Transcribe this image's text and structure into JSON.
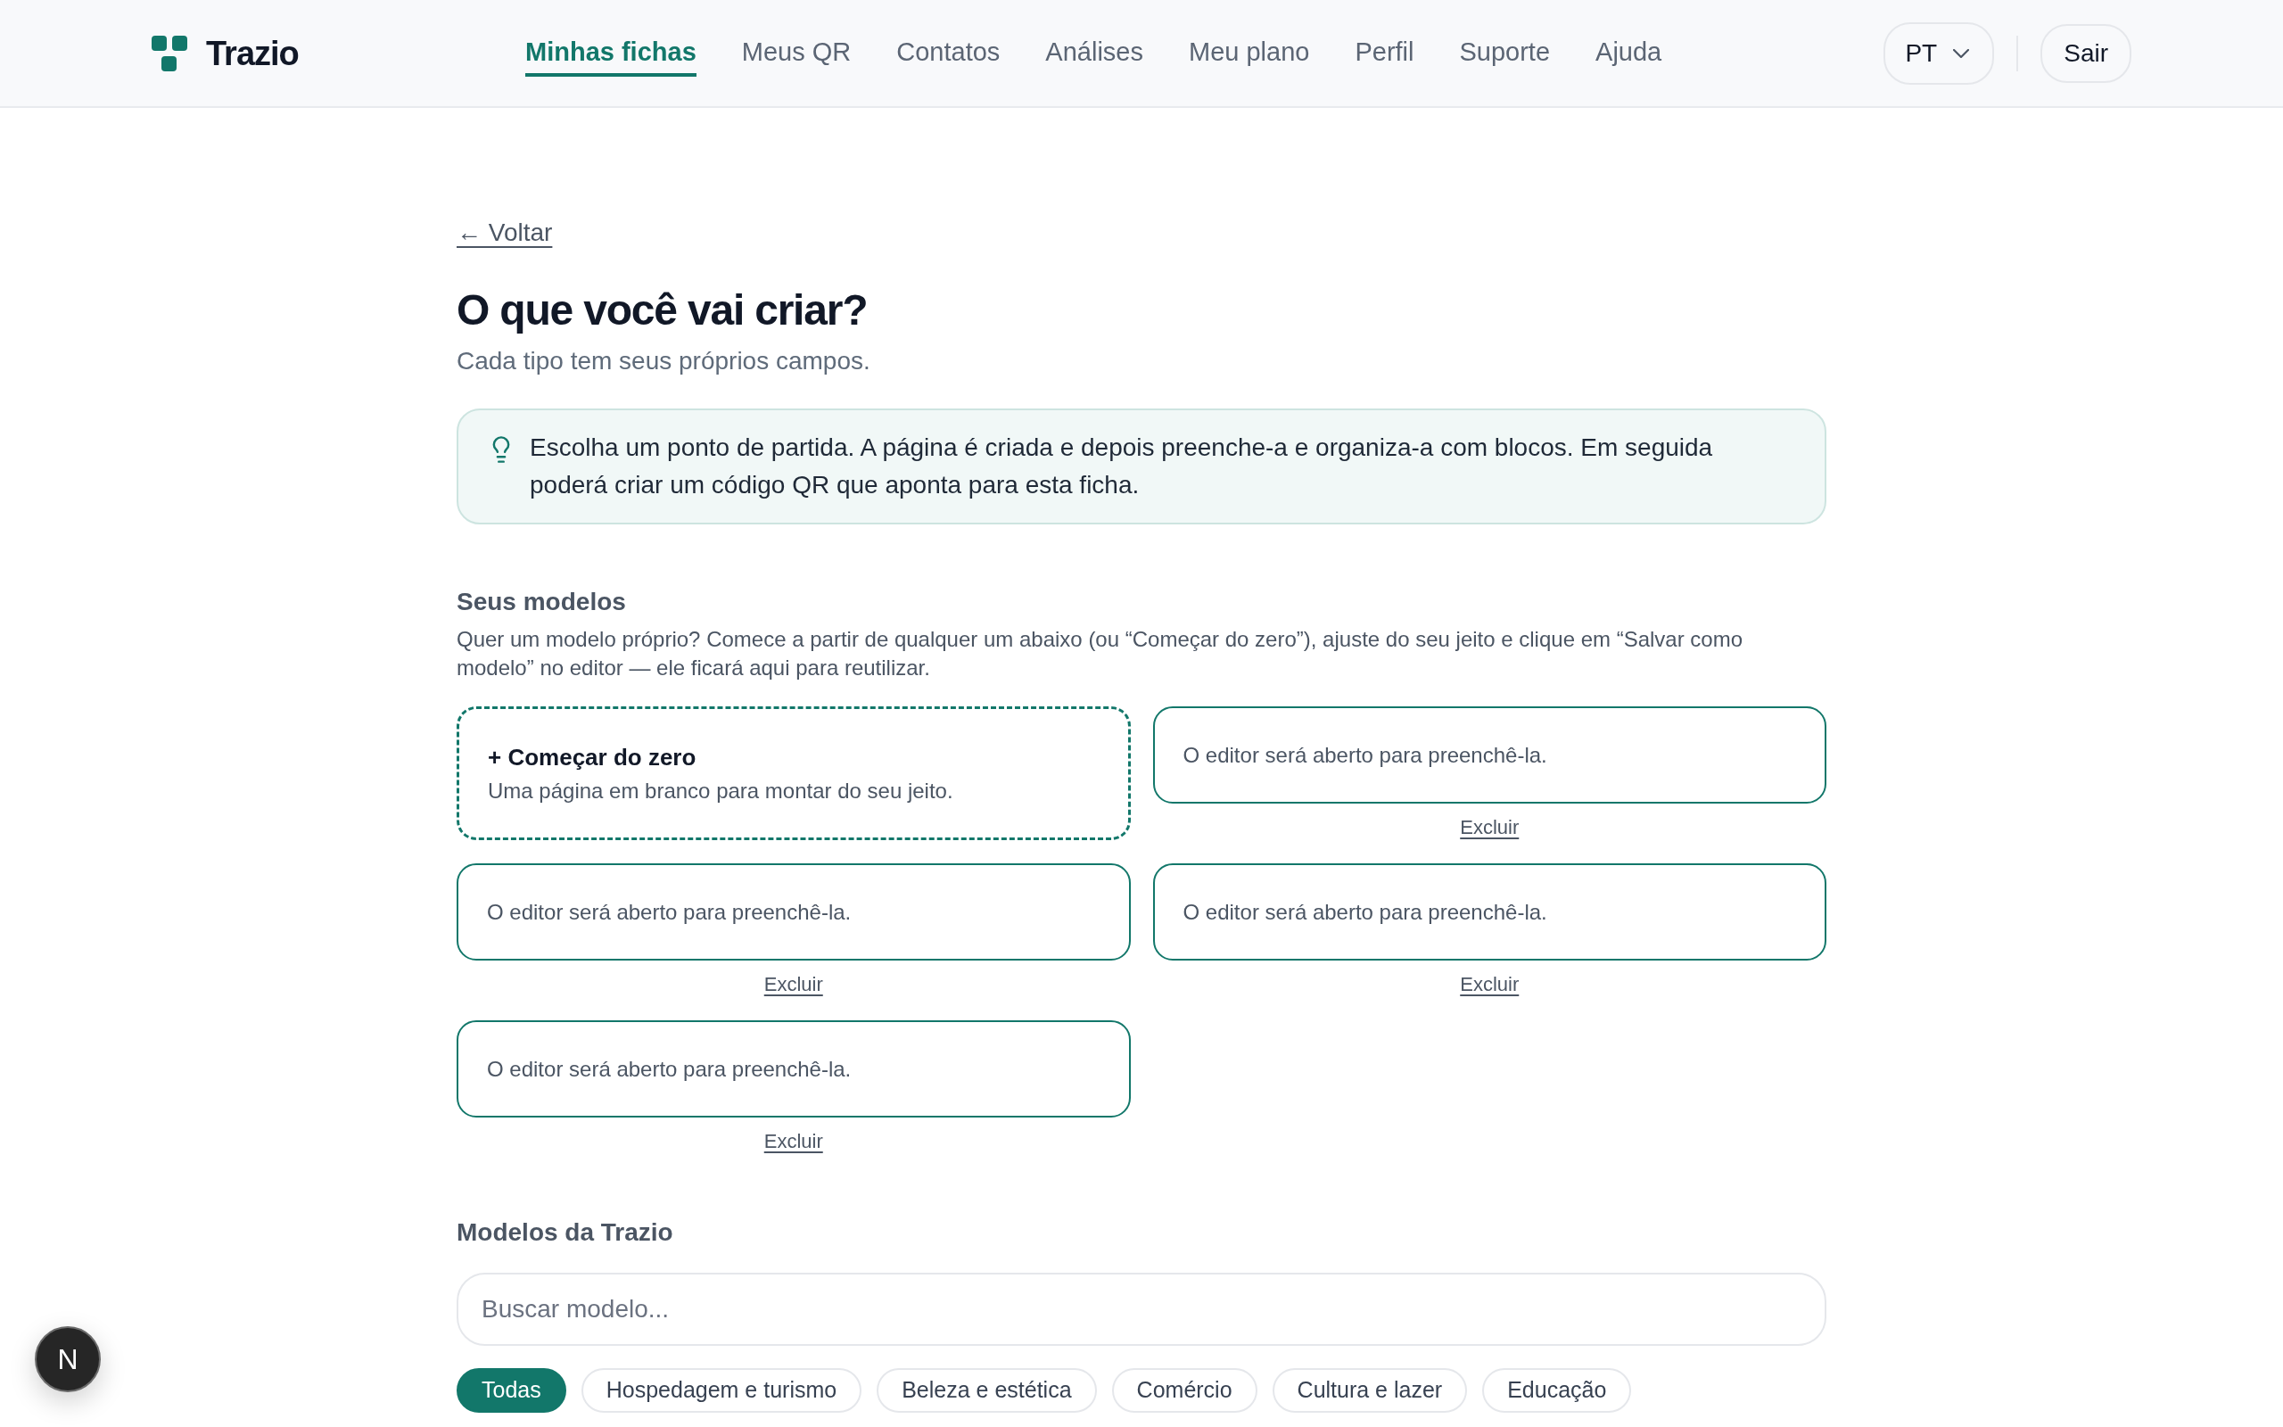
{
  "header": {
    "logo": "Trazio",
    "nav": [
      {
        "label": "Minhas fichas",
        "selected": true
      },
      {
        "label": "Meus QR",
        "selected": false
      },
      {
        "label": "Contatos",
        "selected": false
      },
      {
        "label": "Análises",
        "selected": false
      },
      {
        "label": "Meu plano",
        "selected": false
      },
      {
        "label": "Perfil",
        "selected": false
      },
      {
        "label": "Suporte",
        "selected": false
      },
      {
        "label": "Ajuda",
        "selected": false
      }
    ],
    "language": "PT",
    "logout": "Sair"
  },
  "page": {
    "back": "← Voltar",
    "title": "O que você vai criar?",
    "subtitle": "Cada tipo tem seus próprios campos.",
    "tip": "Escolha um ponto de partida. A página é criada e depois preenche-a e organiza-a com blocos. Em seguida poderá criar um código QR que aponta para esta ficha."
  },
  "my_templates": {
    "heading": "Seus modelos",
    "description": "Quer um modelo próprio? Comece a partir de qualquer um abaixo (ou “Começar do zero”), ajuste do seu jeito e clique em “Salvar como modelo” no editor — ele ficará aqui para reutilizar.",
    "items": [
      {
        "kind": "blank",
        "title": "+ Começar do zero",
        "description": "Uma página em branco para montar do seu jeito."
      },
      {
        "kind": "saved",
        "description": "O editor será aberto para preenchê-la.",
        "delete": "Excluir"
      },
      {
        "kind": "saved",
        "description": "O editor será aberto para preenchê-la.",
        "delete": "Excluir"
      },
      {
        "kind": "saved",
        "description": "O editor será aberto para preenchê-la.",
        "delete": "Excluir"
      },
      {
        "kind": "saved",
        "description": "O editor será aberto para preenchê-la.",
        "delete": "Excluir"
      }
    ]
  },
  "trazio_templates": {
    "heading": "Modelos da Trazio",
    "search": {
      "placeholder": "Buscar modelo..."
    },
    "categories": [
      {
        "label": "Todas",
        "selected": true
      },
      {
        "label": "Hospedagem e turismo",
        "selected": false
      },
      {
        "label": "Beleza e estética",
        "selected": false
      },
      {
        "label": "Comércio",
        "selected": false
      },
      {
        "label": "Cultura e lazer",
        "selected": false
      },
      {
        "label": "Educação",
        "selected": false
      }
    ]
  },
  "dev_badge": {
    "label": "N"
  }
}
